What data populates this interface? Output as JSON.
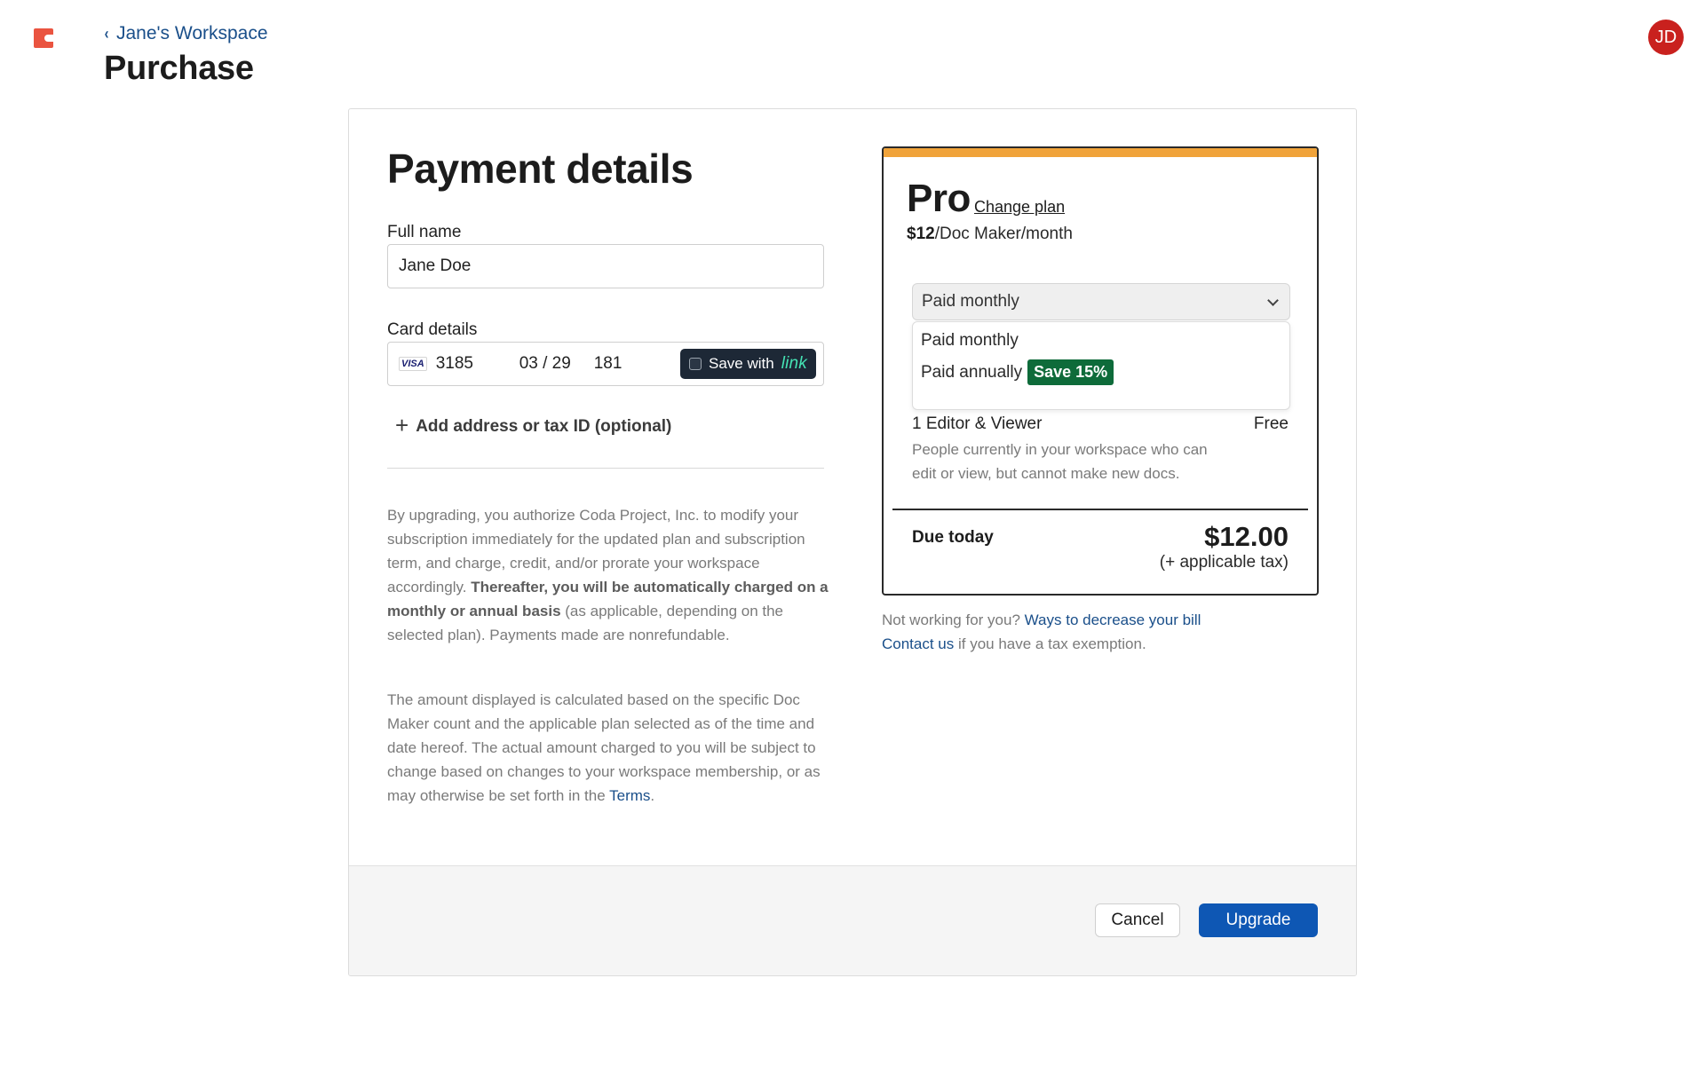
{
  "header": {
    "logo_icon": "coda-logo-icon",
    "breadcrumb": "Jane's Workspace",
    "title": "Purchase",
    "avatar_initials": "JD",
    "brand_color": "#ea5440",
    "avatar_color": "#c9211e"
  },
  "payment": {
    "title": "Payment details",
    "full_name_label": "Full name",
    "full_name_value": "Jane Doe",
    "card_label": "Card details",
    "card_brand": "VISA",
    "card_last4": "3185",
    "card_expiry": "03 / 29",
    "card_cvc": "181",
    "save_with": "Save with",
    "save_brand": "link",
    "add_address": "Add address or tax ID (optional)"
  },
  "legal": {
    "p1_a": "By upgrading, you authorize Coda Project, Inc. to modify your subscription immediately for the updated plan and subscription term, and charge, credit, and/or prorate your workspace accordingly. ",
    "p1_b": "Thereafter, you will be automatically charged on a monthly or annual basis",
    "p1_c": " (as applicable, depending on the selected plan). Payments made are nonrefundable.",
    "p2_a": "The amount displayed is calculated based on the specific Doc Maker count and the applicable plan selected as of the time and date hereof. The actual amount charged to you will be subject to change based on changes to your workspace membership, or as may otherwise be set forth in the ",
    "p2_link": "Terms",
    "p2_end": "."
  },
  "plan": {
    "name": "Pro",
    "change_plan": "Change plan",
    "price_amount": "$12",
    "price_unit": "/Doc Maker/month",
    "billing_selected": "Paid monthly",
    "billing_options": [
      {
        "label": "Paid monthly"
      },
      {
        "label": "Paid annually",
        "badge": "Save 15%"
      }
    ],
    "seat_label": "1 Editor & Viewer",
    "seat_price": "Free",
    "seat_desc": "People currently in your workspace who can edit or view, but cannot make new docs.",
    "due_label": "Due today",
    "due_amount": "$12.00",
    "due_tax": "(+ applicable tax)",
    "accent_color": "#f0a33a",
    "badge_color": "#0e6b3a"
  },
  "help": {
    "line1_text": "Not working for you? ",
    "line1_link": "Ways to decrease your bill",
    "line2_link": "Contact us",
    "line2_text": " if you have a tax exemption."
  },
  "actions": {
    "cancel": "Cancel",
    "upgrade": "Upgrade",
    "upgrade_color": "#0e57b4"
  }
}
